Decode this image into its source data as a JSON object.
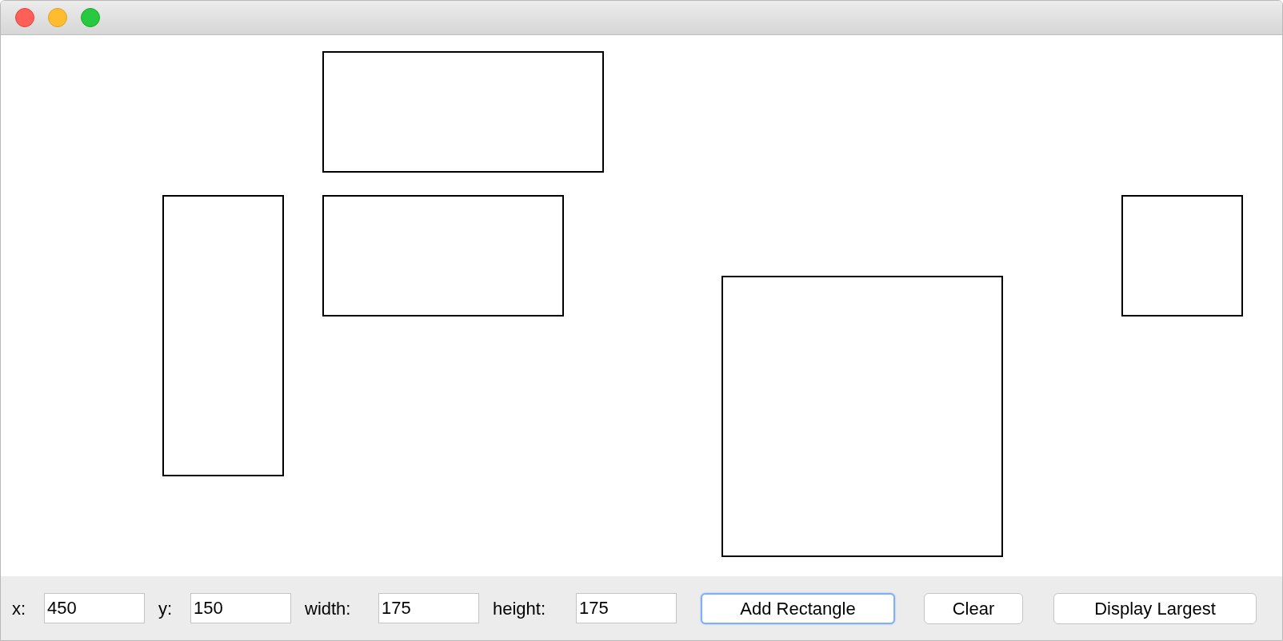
{
  "fields": [
    {
      "label": "x:",
      "value": "450"
    },
    {
      "label": "y:",
      "value": "150"
    },
    {
      "label": "width:",
      "value": "175"
    },
    {
      "label": "height:",
      "value": "175"
    }
  ],
  "buttons": [
    {
      "label": "Add Rectangle",
      "focused": true
    },
    {
      "label": "Clear",
      "focused": false
    },
    {
      "label": "Display Largest",
      "focused": false
    }
  ]
}
